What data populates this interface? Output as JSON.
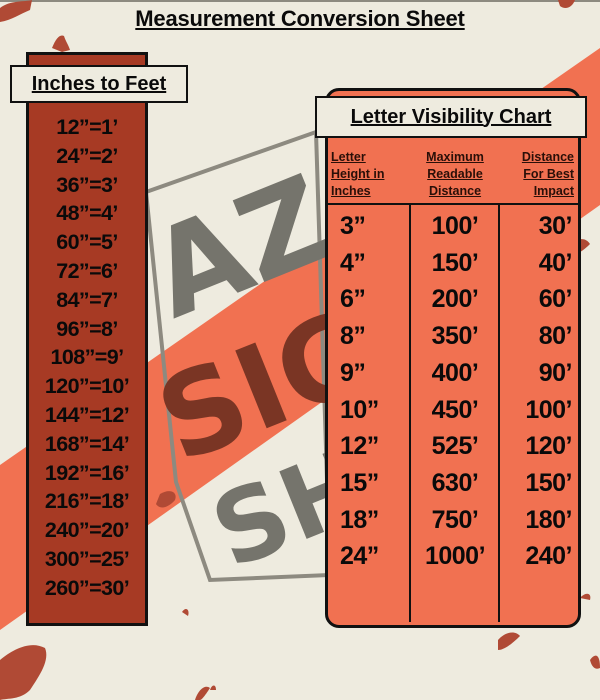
{
  "page": {
    "title": "Measurement Conversion Sheet"
  },
  "colors": {
    "background": "#eeebdf",
    "left_panel": "#a73a24",
    "right_panel": "#f17151",
    "stripe": "#f17151",
    "logo_gray": "#75746c",
    "logo_brown": "#7a3524",
    "splatter": "#b04a35"
  },
  "logo": {
    "line1": "AZ",
    "line2": "SIGN",
    "line3": "SHOP"
  },
  "inches_to_feet": {
    "title": "Inches to Feet",
    "items": [
      "12”=1’",
      "24”=2’",
      "36”=3’",
      "48”=4’",
      "60”=5’",
      "72”=6’",
      "84”=7’",
      "96”=8’",
      "108”=9’",
      "120”=10’",
      "144”=12’",
      "168”=14’",
      "192”=16’",
      "216”=18’",
      "240”=20’",
      "300”=25’",
      "260”=30’"
    ]
  },
  "visibility_chart": {
    "title": "Letter Visibility Chart",
    "columns": [
      "Letter Height in Inches",
      "Maximum Readable Distance",
      "Distance For Best Impact"
    ],
    "column_lines": [
      [
        "Letter",
        "Height in",
        "Inches"
      ],
      [
        "Maximum",
        "Readable",
        "Distance"
      ],
      [
        "Distance",
        "For Best",
        "Impact"
      ]
    ],
    "rows": [
      [
        "3”",
        "100’",
        "30’"
      ],
      [
        "4”",
        "150’",
        "40’"
      ],
      [
        "6”",
        "200’",
        "60’"
      ],
      [
        "8”",
        "350’",
        "80’"
      ],
      [
        "9”",
        "400’",
        "90’"
      ],
      [
        "10”",
        "450’",
        "100’"
      ],
      [
        "12”",
        "525’",
        "120’"
      ],
      [
        "15”",
        "630’",
        "150’"
      ],
      [
        "18”",
        "750’",
        "180’"
      ],
      [
        "24”",
        "1000’",
        "240’"
      ]
    ]
  }
}
